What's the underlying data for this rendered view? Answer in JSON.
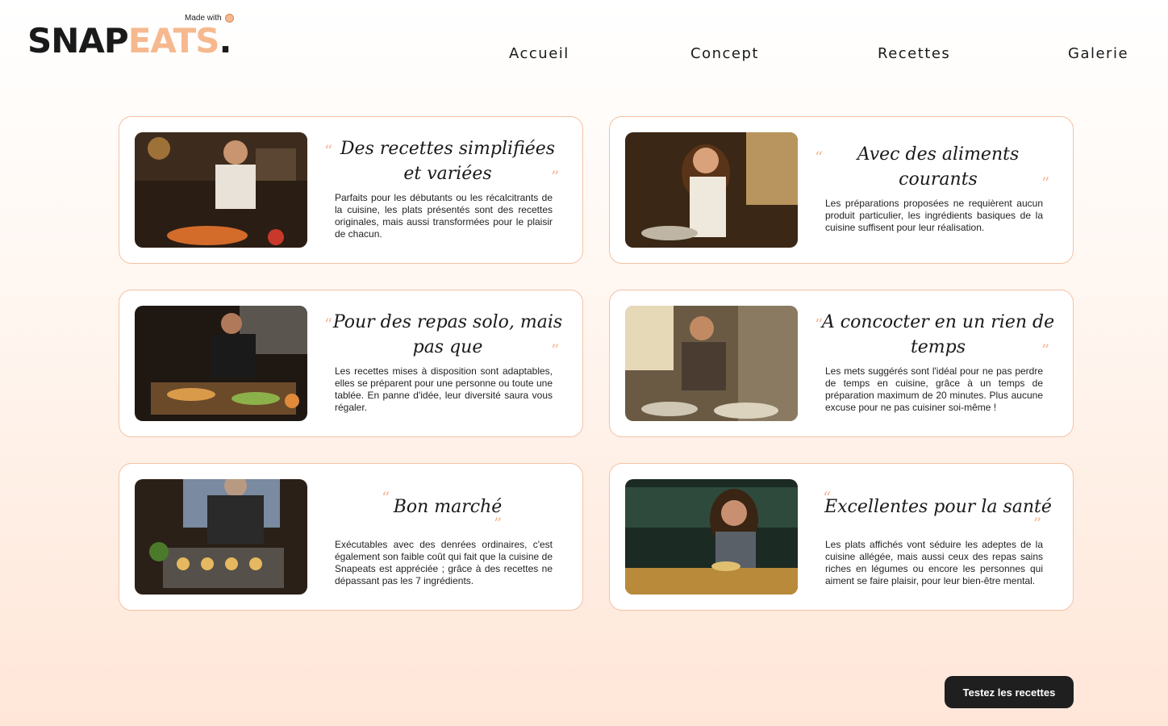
{
  "header": {
    "made_with": "Made with",
    "logo_part1": "SNAP",
    "logo_part2": "EATS",
    "logo_dot": "."
  },
  "nav": {
    "items": [
      "Accueil",
      "Concept",
      "Recettes",
      "Galerie"
    ]
  },
  "cards": [
    {
      "title": "Des recettes simplifiées et variées",
      "text": "Parfaits pour les débutants ou les récalcitrants de la cuisine, les plats présentés sont des recettes originales, mais aussi transformées pour le plaisir de chacun.",
      "image": "chef cooking in kitchen"
    },
    {
      "title": "Avec des aliments courants",
      "text": "Les préparations proposées ne requièrent aucun produit particulier, les ingrédients basiques de la cuisine suffisent pour leur réalisation.",
      "image": "woman smiling while cooking"
    },
    {
      "title": "Pour des repas solo, mais pas que",
      "text": "Les recettes mises à disposition sont adaptables, elles se préparent pour une personne ou toute une tablée. En panne d'idée, leur diversité saura vous régaler.",
      "image": "man preparing tacos"
    },
    {
      "title": "A concocter en un rien de temps",
      "text": "Les mets suggérés sont l'idéal pour ne pas perdre de temps en cuisine, grâce à un temps de préparation maximum de 20 minutes. Plus aucune excuse pour ne pas cuisiner soi-même !",
      "image": "man smiling in kitchen"
    },
    {
      "title": "Bon marché",
      "text": "Exécutables avec des denrées ordinaires, c'est également son faible coût qui fait que la cuisine de Snapeats est appréciée ; grâce à des recettes ne dépassant pas les 7 ingrédients.",
      "image": "older man with muffin tray"
    },
    {
      "title": "Excellentes pour la santé",
      "text": "Les plats affichés vont séduire les adeptes de la cuisine allégée, mais aussi ceux des repas sains riches en légumes ou encore les personnes qui aiment se faire plaisir, pour leur bien-être mental.",
      "image": "woman eating at restaurant"
    }
  ],
  "cta": {
    "label": "Testez les recettes"
  },
  "colors": {
    "accent": "#f6b98f",
    "border": "#f4c2a4",
    "dark": "#1f1f1f"
  }
}
